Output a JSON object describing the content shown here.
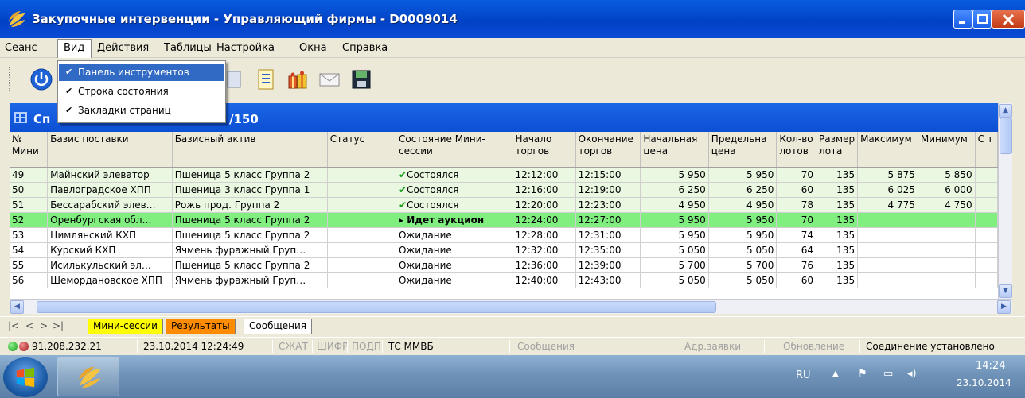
{
  "window": {
    "title": "Закупочные интервенции - Управляющий фирмы - D0009014"
  },
  "menu": [
    "Сеанс",
    "Вид",
    "Действия",
    "Таблицы",
    "Настройка",
    "Окна",
    "Справка"
  ],
  "view_menu": {
    "items": [
      {
        "label": "Панель инструментов",
        "checked": true,
        "highlighted": true
      },
      {
        "label": "Строка состояния",
        "checked": true
      },
      {
        "label": "Закладки страниц",
        "checked": true
      }
    ]
  },
  "pane": {
    "title_left": "Сп",
    "title_right": "/150"
  },
  "table": {
    "columns": [
      "№ Мини",
      "Базис поставки",
      "Базисный актив",
      "Статус",
      "Состояние Мини-сессии",
      "Начало торгов",
      "Окончание торгов",
      "Начальная цена",
      "Предельна цена",
      "Кол-во лотов",
      "Размер лота",
      "Максимум",
      "Минимум",
      "С т"
    ],
    "rows": [
      {
        "n": "49",
        "basis": "Майнский элеватор",
        "asset": "Пшеница 5 класс Группа 2",
        "status": "",
        "state": "Состоялся",
        "start": "12:12:00",
        "end": "12:15:00",
        "price": "5 950",
        "limit": "5 950",
        "lots": "70",
        "size": "135",
        "max": "5 875",
        "min": "5 850",
        "kind": "done"
      },
      {
        "n": "50",
        "basis": "Павлоградское ХПП",
        "asset": "Пшеница 3 класс Группа 1",
        "status": "",
        "state": "Состоялся",
        "start": "12:16:00",
        "end": "12:19:00",
        "price": "6 250",
        "limit": "6 250",
        "lots": "60",
        "size": "135",
        "max": "6 025",
        "min": "6 000",
        "kind": "done"
      },
      {
        "n": "51",
        "basis": "Бессарабский элев…",
        "asset": "Рожь прод. Группа 2",
        "status": "",
        "state": "Состоялся",
        "start": "12:20:00",
        "end": "12:23:00",
        "price": "4 950",
        "limit": "4 950",
        "lots": "78",
        "size": "135",
        "max": "4 775",
        "min": "4 750",
        "kind": "done"
      },
      {
        "n": "52",
        "basis": "Оренбургская обл…",
        "asset": "Пшеница 5 класс Группа 2",
        "status": "",
        "state": "Идет аукцион",
        "start": "12:24:00",
        "end": "12:27:00",
        "price": "5 950",
        "limit": "5 950",
        "lots": "70",
        "size": "135",
        "max": "",
        "min": "",
        "kind": "active"
      },
      {
        "n": "53",
        "basis": "Цимлянский КХП",
        "asset": "Пшеница 5 класс Группа 2",
        "status": "",
        "state": "Ожидание",
        "start": "12:28:00",
        "end": "12:31:00",
        "price": "5 950",
        "limit": "5 950",
        "lots": "74",
        "size": "135",
        "max": "",
        "min": "",
        "kind": "wait"
      },
      {
        "n": "54",
        "basis": "Курский КХП",
        "asset": "Ячмень фуражный Груп…",
        "status": "",
        "state": "Ожидание",
        "start": "12:32:00",
        "end": "12:35:00",
        "price": "5 050",
        "limit": "5 050",
        "lots": "64",
        "size": "135",
        "max": "",
        "min": "",
        "kind": "wait"
      },
      {
        "n": "55",
        "basis": "Исилькульский эл…",
        "asset": "Пшеница 5 класс Группа 2",
        "status": "",
        "state": "Ожидание",
        "start": "12:36:00",
        "end": "12:39:00",
        "price": "5 700",
        "limit": "5 700",
        "lots": "76",
        "size": "135",
        "max": "",
        "min": "",
        "kind": "wait"
      },
      {
        "n": "56",
        "basis": "Шемордановское ХПП",
        "asset": "Ячмень фуражный Груп…",
        "status": "",
        "state": "Ожидание",
        "start": "12:40:00",
        "end": "12:43:00",
        "price": "5 050",
        "limit": "5 050",
        "lots": "60",
        "size": "135",
        "max": "",
        "min": "",
        "kind": "wait"
      }
    ]
  },
  "tabs": [
    "Мини-сессии",
    "Результаты",
    "Сообщения"
  ],
  "status": {
    "ip": "91.208.232.21",
    "datetime": "23.10.2014  12:24:49",
    "flags": [
      "СЖАТ",
      "ШИФР",
      "ПОДП"
    ],
    "exchange": "ТС ММВБ",
    "messages": "Сообщения",
    "orders": "Адр.заявки",
    "update": "Обновление",
    "connection": "Соединение установлено"
  },
  "taskbar": {
    "lang": "RU",
    "time": "14:24",
    "date": "23.10.2014"
  },
  "colors": {
    "title": "#0a5cdf",
    "active_row": "#80ef80",
    "done_row": "#eaf8e2",
    "tab_mini": "#ffff00",
    "tab_results": "#ff8c00"
  }
}
